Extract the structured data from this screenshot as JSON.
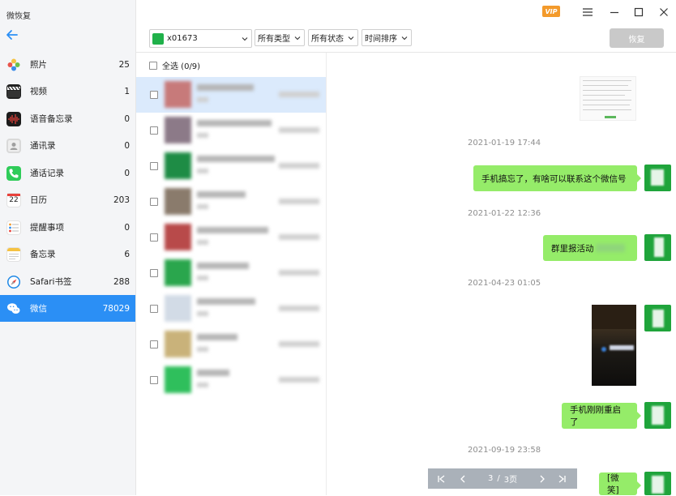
{
  "app": {
    "title": "微恢复"
  },
  "window": {
    "vip_label": "VIP"
  },
  "sidebar": {
    "items": [
      {
        "label": "照片",
        "count": "25",
        "icon": "photos-icon"
      },
      {
        "label": "视频",
        "count": "1",
        "icon": "video-icon"
      },
      {
        "label": "语音备忘录",
        "count": "0",
        "icon": "voice-memo-icon"
      },
      {
        "label": "通讯录",
        "count": "0",
        "icon": "contacts-icon"
      },
      {
        "label": "通话记录",
        "count": "0",
        "icon": "phone-icon"
      },
      {
        "label": "日历",
        "count": "203",
        "icon": "calendar-icon",
        "day": "22"
      },
      {
        "label": "提醒事项",
        "count": "0",
        "icon": "reminders-icon"
      },
      {
        "label": "备忘录",
        "count": "6",
        "icon": "notes-icon"
      },
      {
        "label": "Safari书签",
        "count": "288",
        "icon": "safari-icon"
      },
      {
        "label": "微信",
        "count": "78029",
        "icon": "wechat-icon",
        "active": true
      }
    ]
  },
  "toolbar": {
    "account": "x01673",
    "filters": [
      "所有类型",
      "所有状态",
      "时间排序"
    ],
    "restore_label": "恢复"
  },
  "list": {
    "select_all_label": "全选 (0/9)",
    "row_count": 9
  },
  "messages": {
    "timestamps": [
      "2021-01-19 17:44",
      "2021-01-22 12:36",
      "2021-04-23 01:05",
      "2021-09-19 23:58"
    ],
    "texts": [
      "手机搞忘了，有啥可以联系这个微信号",
      "群里报活动",
      "手机刚刚重启了",
      "[微笑]"
    ]
  },
  "pager": {
    "current": "3",
    "separator": "/",
    "total": "3页"
  },
  "colors": {
    "accent": "#2b8ff5",
    "bubble": "#95ec69",
    "vip": "#f39a2b",
    "wechat_green": "#1fa43b"
  }
}
